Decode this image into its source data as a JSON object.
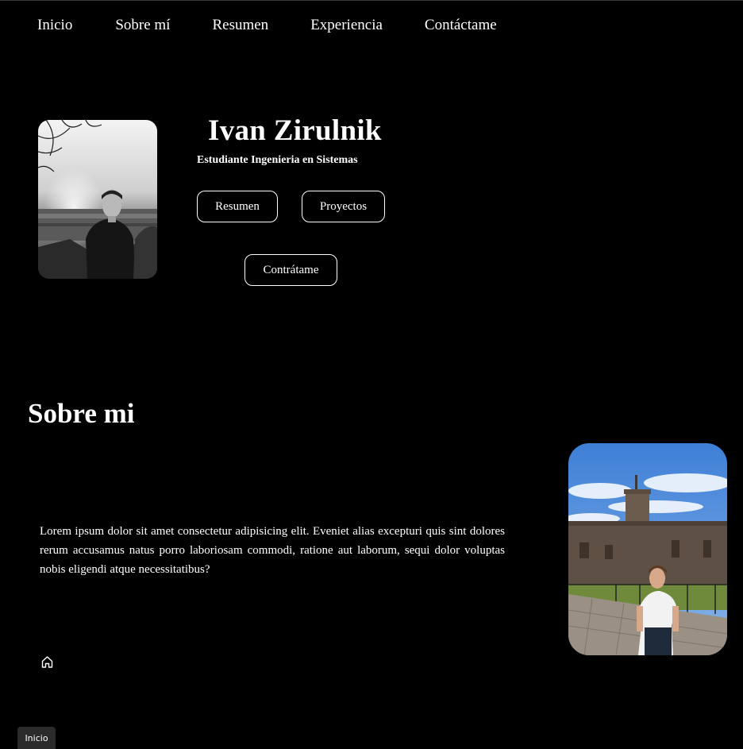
{
  "nav": {
    "items": [
      {
        "label": "Inicio"
      },
      {
        "label": "Sobre mí"
      },
      {
        "label": "Resumen"
      },
      {
        "label": "Experiencia"
      },
      {
        "label": "Contáctame"
      }
    ]
  },
  "hero": {
    "name": "Ivan Zirulnik",
    "subtitle": "Estudiante Ingenieria en Sistemas",
    "photo_alt": "profile-photo-bw",
    "buttons": {
      "resumen": "Resumen",
      "proyectos": "Proyectos",
      "contratame": "Contrátame"
    }
  },
  "about": {
    "title": "Sobre mi",
    "text": "Lorem ipsum dolor sit amet consectetur adipisicing elit. Eveniet alias excepturi quis sint dolores rerum accusamus natus porro laboriosam commodi, ratione aut laborum, sequi dolor voluptas nobis eligendi atque necessitatibus?",
    "photo_alt": "about-photo-castle"
  },
  "home_icon": "home-icon",
  "tooltip": {
    "label": "Inicio"
  },
  "colors": {
    "background": "#000000",
    "text": "#ffffff",
    "tooltip_bg": "#2b2b2b"
  }
}
